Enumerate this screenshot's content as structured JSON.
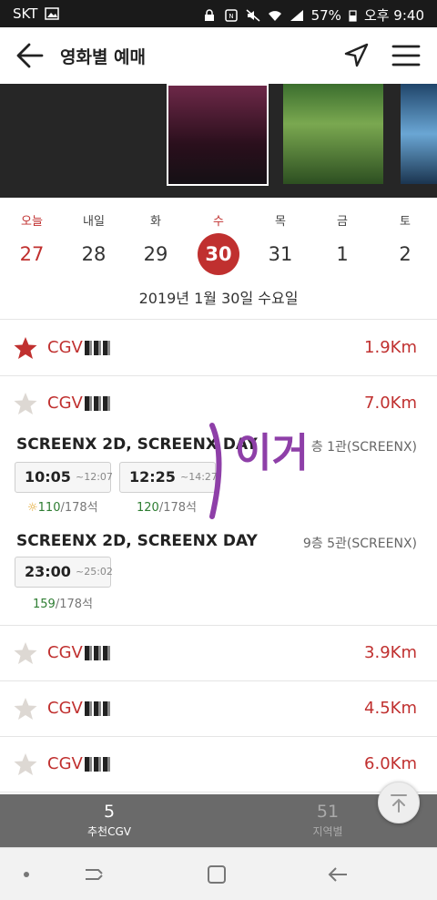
{
  "status": {
    "carrier": "SKT",
    "battery": "57%",
    "time": "오후 9:40"
  },
  "header": {
    "title": "영화별 예매"
  },
  "calendar": {
    "days": [
      {
        "name": "오늘",
        "num": "27"
      },
      {
        "name": "내일",
        "num": "28"
      },
      {
        "name": "화",
        "num": "29"
      },
      {
        "name": "수",
        "num": "30"
      },
      {
        "name": "목",
        "num": "31"
      },
      {
        "name": "금",
        "num": "1"
      },
      {
        "name": "토",
        "num": "2"
      }
    ],
    "selected_index": 3,
    "full_date": "2019년 1월 30일 수요일"
  },
  "theaters": [
    {
      "name": "CGV",
      "distance": "1.9Km",
      "favorite": true
    },
    {
      "name": "CGV",
      "distance": "7.0Km",
      "favorite": false
    },
    {
      "name": "CGV",
      "distance": "3.9Km",
      "favorite": false
    },
    {
      "name": "CGV",
      "distance": "4.5Km",
      "favorite": false
    },
    {
      "name": "CGV",
      "distance": "6.0Km",
      "favorite": false
    }
  ],
  "showtimes": [
    {
      "format": "SCREENX 2D, SCREENX DAY",
      "hall": "층 1관(SCREENX)",
      "times": [
        {
          "start": "10:05",
          "end": "~12:07",
          "available": "110",
          "total": "/178석"
        },
        {
          "start": "12:25",
          "end": "~14:27",
          "available": "120",
          "total": "/178석"
        }
      ]
    },
    {
      "format": "SCREENX 2D, SCREENX DAY",
      "hall": "9층 5관(SCREENX)",
      "times": [
        {
          "start": "23:00",
          "end": "~25:02",
          "available": "159",
          "total": "/178석"
        }
      ]
    }
  ],
  "annotation": {
    "text": "이거"
  },
  "tabs": [
    {
      "num": "5",
      "label": "추천CGV"
    },
    {
      "num": "51",
      "label": "지역별"
    }
  ],
  "colors": {
    "accent": "#c0302f",
    "seats_available": "#2e7d32"
  }
}
